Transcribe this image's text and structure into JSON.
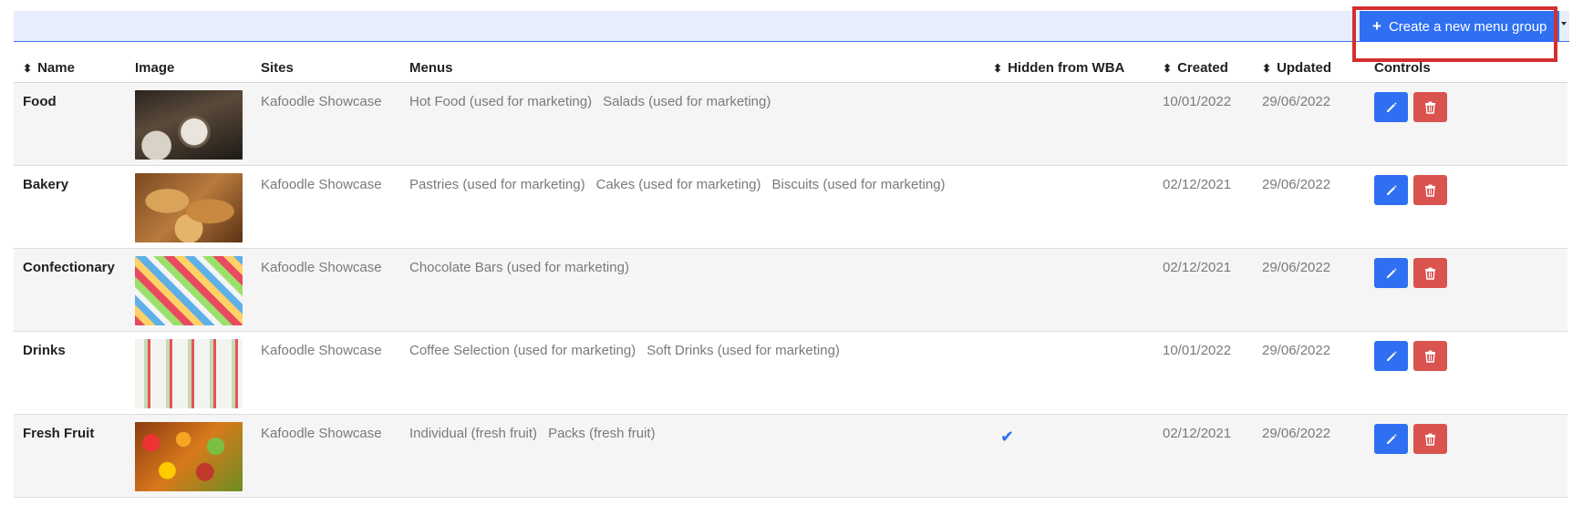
{
  "toolbar": {
    "create_label": "Create a new menu group"
  },
  "table": {
    "headers": {
      "name": "Name",
      "image": "Image",
      "sites": "Sites",
      "menus": "Menus",
      "hidden": "Hidden from WBA",
      "created": "Created",
      "updated": "Updated",
      "controls": "Controls"
    },
    "rows": [
      {
        "name": "Food",
        "image": "restaurant-dining-photo",
        "sites": "Kafoodle Showcase",
        "menus": [
          "Hot Food (used for marketing)",
          "Salads (used for marketing)"
        ],
        "hidden": false,
        "created": "10/01/2022",
        "updated": "29/06/2022"
      },
      {
        "name": "Bakery",
        "image": "bread-loaves-photo",
        "sites": "Kafoodle Showcase",
        "menus": [
          "Pastries (used for marketing)",
          "Cakes (used for marketing)",
          "Biscuits (used for marketing)"
        ],
        "hidden": false,
        "created": "02/12/2021",
        "updated": "29/06/2022"
      },
      {
        "name": "Confectionary",
        "image": "candy-display-photo",
        "sites": "Kafoodle Showcase",
        "menus": [
          "Chocolate Bars (used for marketing)"
        ],
        "hidden": false,
        "created": "02/12/2021",
        "updated": "29/06/2022"
      },
      {
        "name": "Drinks",
        "image": "bottled-drinks-photo",
        "sites": "Kafoodle Showcase",
        "menus": [
          "Coffee Selection (used for marketing)",
          "Soft Drinks (used for marketing)"
        ],
        "hidden": false,
        "created": "10/01/2022",
        "updated": "29/06/2022"
      },
      {
        "name": "Fresh Fruit",
        "image": "fruit-market-photo",
        "sites": "Kafoodle Showcase",
        "menus": [
          "Individual (fresh fruit)",
          "Packs (fresh fruit)"
        ],
        "hidden": true,
        "created": "02/12/2021",
        "updated": "29/06/2022"
      }
    ]
  },
  "icons": {
    "edit": "pencil-icon",
    "delete": "trash-icon",
    "sort": "sort-icon",
    "hidden_check": "checkmark-icon",
    "add": "plus-icon",
    "dropdown": "caret-down-icon"
  },
  "colors": {
    "primary": "#2f6ff2",
    "danger": "#d9534f",
    "highlight": "#d32f2f",
    "topbar": "#e7eefd"
  }
}
